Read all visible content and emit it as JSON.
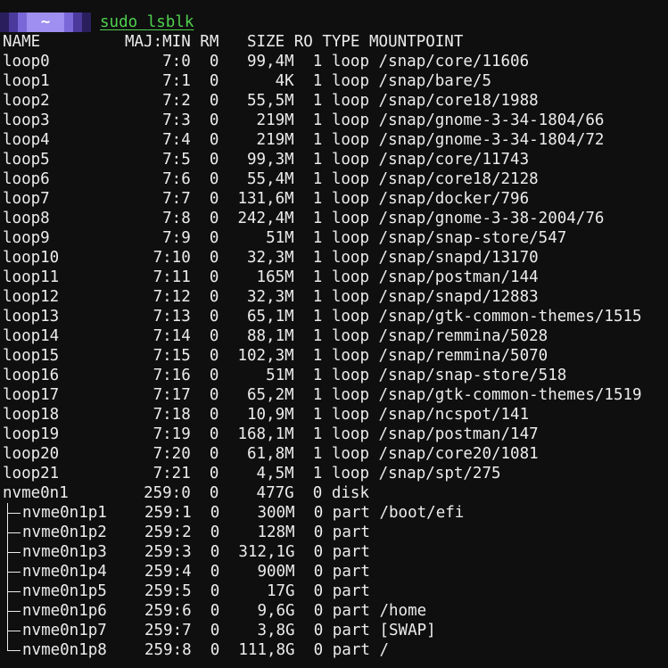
{
  "prompt": {
    "badge_text": "~",
    "command": "sudo",
    "argument": "lsblk"
  },
  "header": {
    "name": "NAME",
    "majmin": "MAJ:MIN",
    "rm": "RM",
    "size": "SIZE",
    "ro": "RO",
    "type": "TYPE",
    "mountpoint": "MOUNTPOINT"
  },
  "devices": [
    {
      "name": "loop0",
      "majmin": "7:0",
      "rm": "0",
      "size": "99,4M",
      "ro": "1",
      "type": "loop",
      "mountpoint": "/snap/core/11606"
    },
    {
      "name": "loop1",
      "majmin": "7:1",
      "rm": "0",
      "size": "4K",
      "ro": "1",
      "type": "loop",
      "mountpoint": "/snap/bare/5"
    },
    {
      "name": "loop2",
      "majmin": "7:2",
      "rm": "0",
      "size": "55,5M",
      "ro": "1",
      "type": "loop",
      "mountpoint": "/snap/core18/1988"
    },
    {
      "name": "loop3",
      "majmin": "7:3",
      "rm": "0",
      "size": "219M",
      "ro": "1",
      "type": "loop",
      "mountpoint": "/snap/gnome-3-34-1804/66"
    },
    {
      "name": "loop4",
      "majmin": "7:4",
      "rm": "0",
      "size": "219M",
      "ro": "1",
      "type": "loop",
      "mountpoint": "/snap/gnome-3-34-1804/72"
    },
    {
      "name": "loop5",
      "majmin": "7:5",
      "rm": "0",
      "size": "99,3M",
      "ro": "1",
      "type": "loop",
      "mountpoint": "/snap/core/11743"
    },
    {
      "name": "loop6",
      "majmin": "7:6",
      "rm": "0",
      "size": "55,4M",
      "ro": "1",
      "type": "loop",
      "mountpoint": "/snap/core18/2128"
    },
    {
      "name": "loop7",
      "majmin": "7:7",
      "rm": "0",
      "size": "131,6M",
      "ro": "1",
      "type": "loop",
      "mountpoint": "/snap/docker/796"
    },
    {
      "name": "loop8",
      "majmin": "7:8",
      "rm": "0",
      "size": "242,4M",
      "ro": "1",
      "type": "loop",
      "mountpoint": "/snap/gnome-3-38-2004/76"
    },
    {
      "name": "loop9",
      "majmin": "7:9",
      "rm": "0",
      "size": "51M",
      "ro": "1",
      "type": "loop",
      "mountpoint": "/snap/snap-store/547"
    },
    {
      "name": "loop10",
      "majmin": "7:10",
      "rm": "0",
      "size": "32,3M",
      "ro": "1",
      "type": "loop",
      "mountpoint": "/snap/snapd/13170"
    },
    {
      "name": "loop11",
      "majmin": "7:11",
      "rm": "0",
      "size": "165M",
      "ro": "1",
      "type": "loop",
      "mountpoint": "/snap/postman/144"
    },
    {
      "name": "loop12",
      "majmin": "7:12",
      "rm": "0",
      "size": "32,3M",
      "ro": "1",
      "type": "loop",
      "mountpoint": "/snap/snapd/12883"
    },
    {
      "name": "loop13",
      "majmin": "7:13",
      "rm": "0",
      "size": "65,1M",
      "ro": "1",
      "type": "loop",
      "mountpoint": "/snap/gtk-common-themes/1515"
    },
    {
      "name": "loop14",
      "majmin": "7:14",
      "rm": "0",
      "size": "88,1M",
      "ro": "1",
      "type": "loop",
      "mountpoint": "/snap/remmina/5028"
    },
    {
      "name": "loop15",
      "majmin": "7:15",
      "rm": "0",
      "size": "102,3M",
      "ro": "1",
      "type": "loop",
      "mountpoint": "/snap/remmina/5070"
    },
    {
      "name": "loop16",
      "majmin": "7:16",
      "rm": "0",
      "size": "51M",
      "ro": "1",
      "type": "loop",
      "mountpoint": "/snap/snap-store/518"
    },
    {
      "name": "loop17",
      "majmin": "7:17",
      "rm": "0",
      "size": "65,2M",
      "ro": "1",
      "type": "loop",
      "mountpoint": "/snap/gtk-common-themes/1519"
    },
    {
      "name": "loop18",
      "majmin": "7:18",
      "rm": "0",
      "size": "10,9M",
      "ro": "1",
      "type": "loop",
      "mountpoint": "/snap/ncspot/141"
    },
    {
      "name": "loop19",
      "majmin": "7:19",
      "rm": "0",
      "size": "168,1M",
      "ro": "1",
      "type": "loop",
      "mountpoint": "/snap/postman/147"
    },
    {
      "name": "loop20",
      "majmin": "7:20",
      "rm": "0",
      "size": "61,8M",
      "ro": "1",
      "type": "loop",
      "mountpoint": "/snap/core20/1081"
    },
    {
      "name": "loop21",
      "majmin": "7:21",
      "rm": "0",
      "size": "4,5M",
      "ro": "1",
      "type": "loop",
      "mountpoint": "/snap/spt/275"
    },
    {
      "name": "nvme0n1",
      "majmin": "259:0",
      "rm": "0",
      "size": "477G",
      "ro": "0",
      "type": "disk",
      "mountpoint": ""
    }
  ],
  "partitions": [
    {
      "name": "nvme0n1p1",
      "majmin": "259:1",
      "rm": "0",
      "size": "300M",
      "ro": "0",
      "type": "part",
      "mountpoint": "/boot/efi"
    },
    {
      "name": "nvme0n1p2",
      "majmin": "259:2",
      "rm": "0",
      "size": "128M",
      "ro": "0",
      "type": "part",
      "mountpoint": ""
    },
    {
      "name": "nvme0n1p3",
      "majmin": "259:3",
      "rm": "0",
      "size": "312,1G",
      "ro": "0",
      "type": "part",
      "mountpoint": ""
    },
    {
      "name": "nvme0n1p4",
      "majmin": "259:4",
      "rm": "0",
      "size": "900M",
      "ro": "0",
      "type": "part",
      "mountpoint": ""
    },
    {
      "name": "nvme0n1p5",
      "majmin": "259:5",
      "rm": "0",
      "size": "17G",
      "ro": "0",
      "type": "part",
      "mountpoint": ""
    },
    {
      "name": "nvme0n1p6",
      "majmin": "259:6",
      "rm": "0",
      "size": "9,6G",
      "ro": "0",
      "type": "part",
      "mountpoint": "/home"
    },
    {
      "name": "nvme0n1p7",
      "majmin": "259:7",
      "rm": "0",
      "size": "3,8G",
      "ro": "0",
      "type": "part",
      "mountpoint": "[SWAP]"
    },
    {
      "name": "nvme0n1p8",
      "majmin": "259:8",
      "rm": "0",
      "size": "111,8G",
      "ro": "0",
      "type": "part",
      "mountpoint": "/"
    }
  ],
  "colors": {
    "background": "#0f0f0f",
    "text": "#ececec",
    "command": "#4fd14f",
    "badge": "#9e8ff0"
  }
}
